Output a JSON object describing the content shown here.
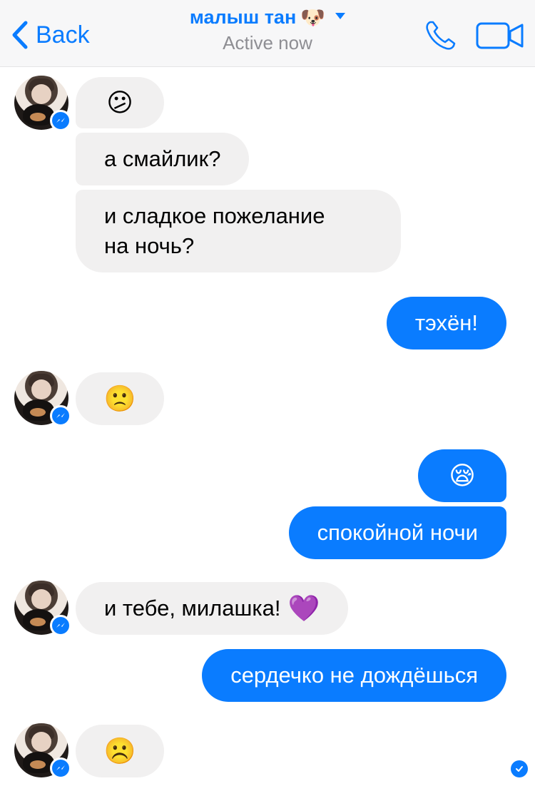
{
  "header": {
    "back_label": "Back",
    "title": "малыш тан",
    "title_emoji": "🐶",
    "subtitle": "Active now"
  },
  "messages": [
    {
      "from": "them",
      "text": "😕",
      "emoji_only": true
    },
    {
      "from": "them",
      "text": "а смайлик?"
    },
    {
      "from": "them",
      "lines": [
        "и сладкое пожелание",
        "на ночь?"
      ]
    },
    {
      "from": "me",
      "text": "тэхён!"
    },
    {
      "from": "them",
      "text": "🙁",
      "emoji_only": true
    },
    {
      "from": "me",
      "text": "😪",
      "emoji_only": true
    },
    {
      "from": "me",
      "text": "спокойной ночи"
    },
    {
      "from": "them",
      "text": "и тебе, милашка!",
      "emoji": "💜"
    },
    {
      "from": "me",
      "text": "сердечко не дождёшься"
    },
    {
      "from": "them",
      "text": "☹️",
      "emoji_only": true
    }
  ],
  "colors": {
    "accent": "#0a7cff",
    "incoming_bubble": "#f1f0f0",
    "outgoing_bubble": "#0a7cff",
    "header_bg": "#f7f7f8",
    "subtitle": "#8e8e93"
  },
  "icons": {
    "back": "chevron-left-icon",
    "caret": "caret-down-icon",
    "phone": "phone-icon",
    "video": "video-camera-icon",
    "avatar_badge": "messenger-icon",
    "seen": "check-circle-icon"
  }
}
